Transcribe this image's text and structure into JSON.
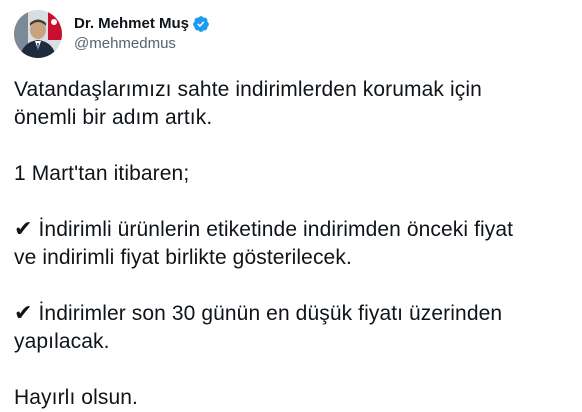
{
  "author": {
    "display_name": "Dr. Mehmet Muş",
    "handle": "@mehmedmus",
    "verified_color": "#1d9bf0"
  },
  "tweet": {
    "line1": "Vatandaşlarımızı sahte indirimlerden korumak için",
    "line2": "önemli bir adım artık.",
    "line3": "1 Mart'tan itibaren;",
    "check_glyph": "✔",
    "item1_line1": " İndirimli ürünlerin etiketinde indirimden önceki fiyat",
    "item1_line2": "ve indirimli fiyat birlikte gösterilecek.",
    "item2_line1": " İndirimler son 30 günün en düşük fiyatı üzerinden",
    "item2_line2": "yapılacak.",
    "closing": "Hayırlı olsun."
  },
  "colors": {
    "text": "#0f1419",
    "secondary": "#536471",
    "accent": "#1d9bf0"
  }
}
